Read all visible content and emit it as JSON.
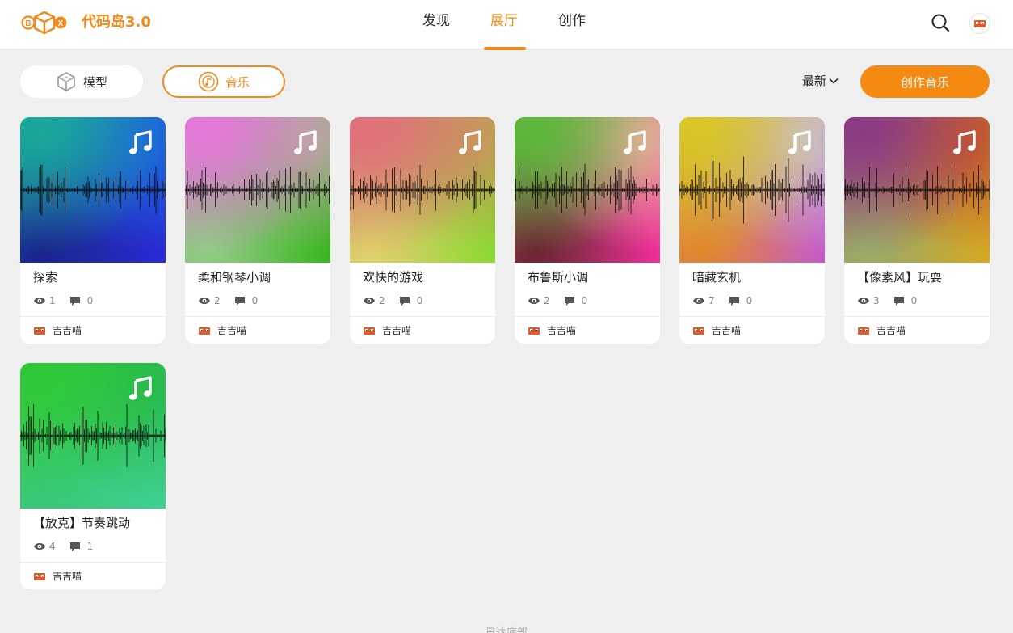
{
  "brand": {
    "logo_letters": [
      "B",
      "X"
    ],
    "name": "代码岛3.0"
  },
  "nav": {
    "items": [
      {
        "label": "发现",
        "active": false
      },
      {
        "label": "展厅",
        "active": true
      },
      {
        "label": "创作",
        "active": false
      }
    ]
  },
  "filters": {
    "model_label": "模型",
    "music_label": "音乐",
    "selected": "音乐"
  },
  "sort": {
    "label": "最新"
  },
  "create_button": {
    "label": "创作音乐"
  },
  "colors": {
    "accent": "#f08a1c",
    "button": "#f58a12"
  },
  "cards": [
    {
      "title": "探索",
      "views": "1",
      "comments": "0",
      "author": "吉吉喵",
      "gradient": [
        "#1aa89a",
        "#1b66e0",
        "#1a1f8c",
        "#2a2ad8"
      ]
    },
    {
      "title": "柔和钢琴小调",
      "views": "2",
      "comments": "0",
      "author": "吉吉喵",
      "gradient": [
        "#e478d9",
        "#b9a9a0",
        "#8fcf83",
        "#35b61a"
      ]
    },
    {
      "title": "欢快的游戏",
      "views": "2",
      "comments": "0",
      "author": "吉吉喵",
      "gradient": [
        "#e0707a",
        "#c59a58",
        "#e0d36b",
        "#87da2f"
      ]
    },
    {
      "title": "布鲁斯小调",
      "views": "2",
      "comments": "0",
      "author": "吉吉喵",
      "gradient": [
        "#5cb83a",
        "#efb0a0",
        "#6a1f30",
        "#f52e9e"
      ]
    },
    {
      "title": "暗藏玄机",
      "views": "7",
      "comments": "0",
      "author": "吉吉喵",
      "gradient": [
        "#d8c626",
        "#c9c2d4",
        "#e2842a",
        "#c45ad0"
      ]
    },
    {
      "title": "【像素风】玩耍",
      "views": "3",
      "comments": "0",
      "author": "吉吉喵",
      "gradient": [
        "#8c3a84",
        "#c7562a",
        "#98b06a",
        "#d8a81c"
      ]
    },
    {
      "title": "【放克】节奏跳动",
      "views": "4",
      "comments": "1",
      "author": "吉吉喵",
      "gradient": [
        "#30c838",
        "#26b84a",
        "#3ac77a",
        "#3ed091"
      ]
    }
  ],
  "footer": {
    "label": "已达底部"
  }
}
